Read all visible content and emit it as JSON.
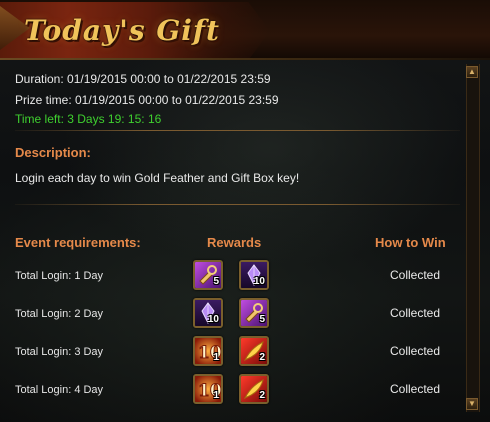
{
  "header": {
    "title": "Today's Gift"
  },
  "event": {
    "duration": "Duration: 01/19/2015 00:00 to 01/22/2015 23:59",
    "prize_time": "Prize time: 01/19/2015 00:00 to 01/22/2015 23:59",
    "time_left": "Time left: 3 Days  19: 15: 16"
  },
  "description": {
    "title": "Description:",
    "text": "Login each day to win Gold Feather and Gift Box key!"
  },
  "table": {
    "headers": {
      "requirements": "Event requirements:",
      "rewards": "Rewards",
      "how_to_win": "How to Win"
    },
    "rows": [
      {
        "label": "Total Login: 1 Day",
        "status": "Collected",
        "rewards": [
          {
            "icon": "gift-box-key-icon",
            "count": "5"
          },
          {
            "icon": "purple-crystal-icon",
            "count": "10"
          }
        ]
      },
      {
        "label": "Total Login: 2 Day",
        "status": "Collected",
        "rewards": [
          {
            "icon": "purple-crystal-icon",
            "count": "10"
          },
          {
            "icon": "gift-box-key-icon",
            "count": "5"
          }
        ]
      },
      {
        "label": "Total Login: 3 Day",
        "status": "Collected",
        "rewards": [
          {
            "icon": "ten-badge-icon",
            "count": "1"
          },
          {
            "icon": "gold-feather-icon",
            "count": "2"
          }
        ]
      },
      {
        "label": "Total Login: 4 Day",
        "status": "Collected",
        "rewards": [
          {
            "icon": "ten-badge-icon",
            "count": "1"
          },
          {
            "icon": "gold-feather-icon",
            "count": "2"
          }
        ]
      }
    ]
  },
  "colors": {
    "title": "#f0c35a",
    "section": "#e5894a",
    "time_left": "#3fcf2f"
  }
}
